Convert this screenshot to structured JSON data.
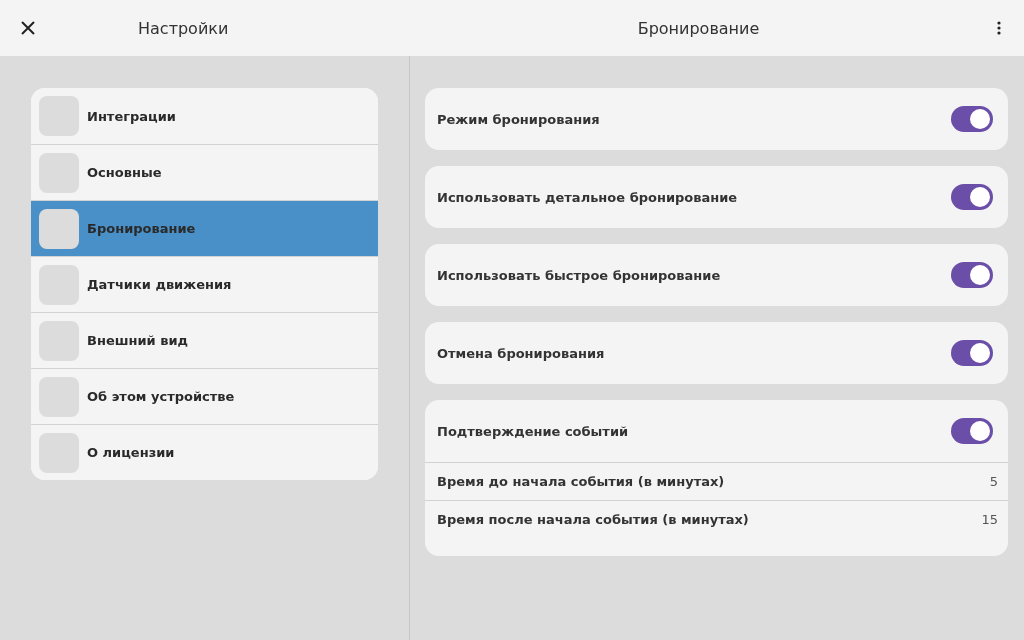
{
  "header": {
    "title": "Настройки",
    "page_title": "Бронирование"
  },
  "sidebar": {
    "items": [
      {
        "label": "Интеграции",
        "selected": false
      },
      {
        "label": "Основные",
        "selected": false
      },
      {
        "label": "Бронирование",
        "selected": true
      },
      {
        "label": "Датчики движения",
        "selected": false
      },
      {
        "label": "Внешний вид",
        "selected": false
      },
      {
        "label": "Об этом устройстве",
        "selected": false
      },
      {
        "label": "О лицензии",
        "selected": false
      }
    ]
  },
  "groups": [
    {
      "rows": [
        {
          "kind": "toggle",
          "label": "Режим бронирования",
          "on": true
        }
      ]
    },
    {
      "rows": [
        {
          "kind": "toggle",
          "label": "Использовать детальное бронирование",
          "on": true
        }
      ]
    },
    {
      "rows": [
        {
          "kind": "toggle",
          "label": "Использовать быстрое бронирование",
          "on": true
        }
      ]
    },
    {
      "rows": [
        {
          "kind": "toggle",
          "label": "Отмена бронирования",
          "on": true
        }
      ]
    },
    {
      "rows": [
        {
          "kind": "toggle",
          "label": "Подтверждение событий",
          "on": true
        },
        {
          "kind": "value",
          "label": "Время до начала события (в минутах)",
          "value": "5"
        },
        {
          "kind": "value",
          "label": "Время после начала события (в минутах)",
          "value": "15"
        }
      ]
    }
  ]
}
